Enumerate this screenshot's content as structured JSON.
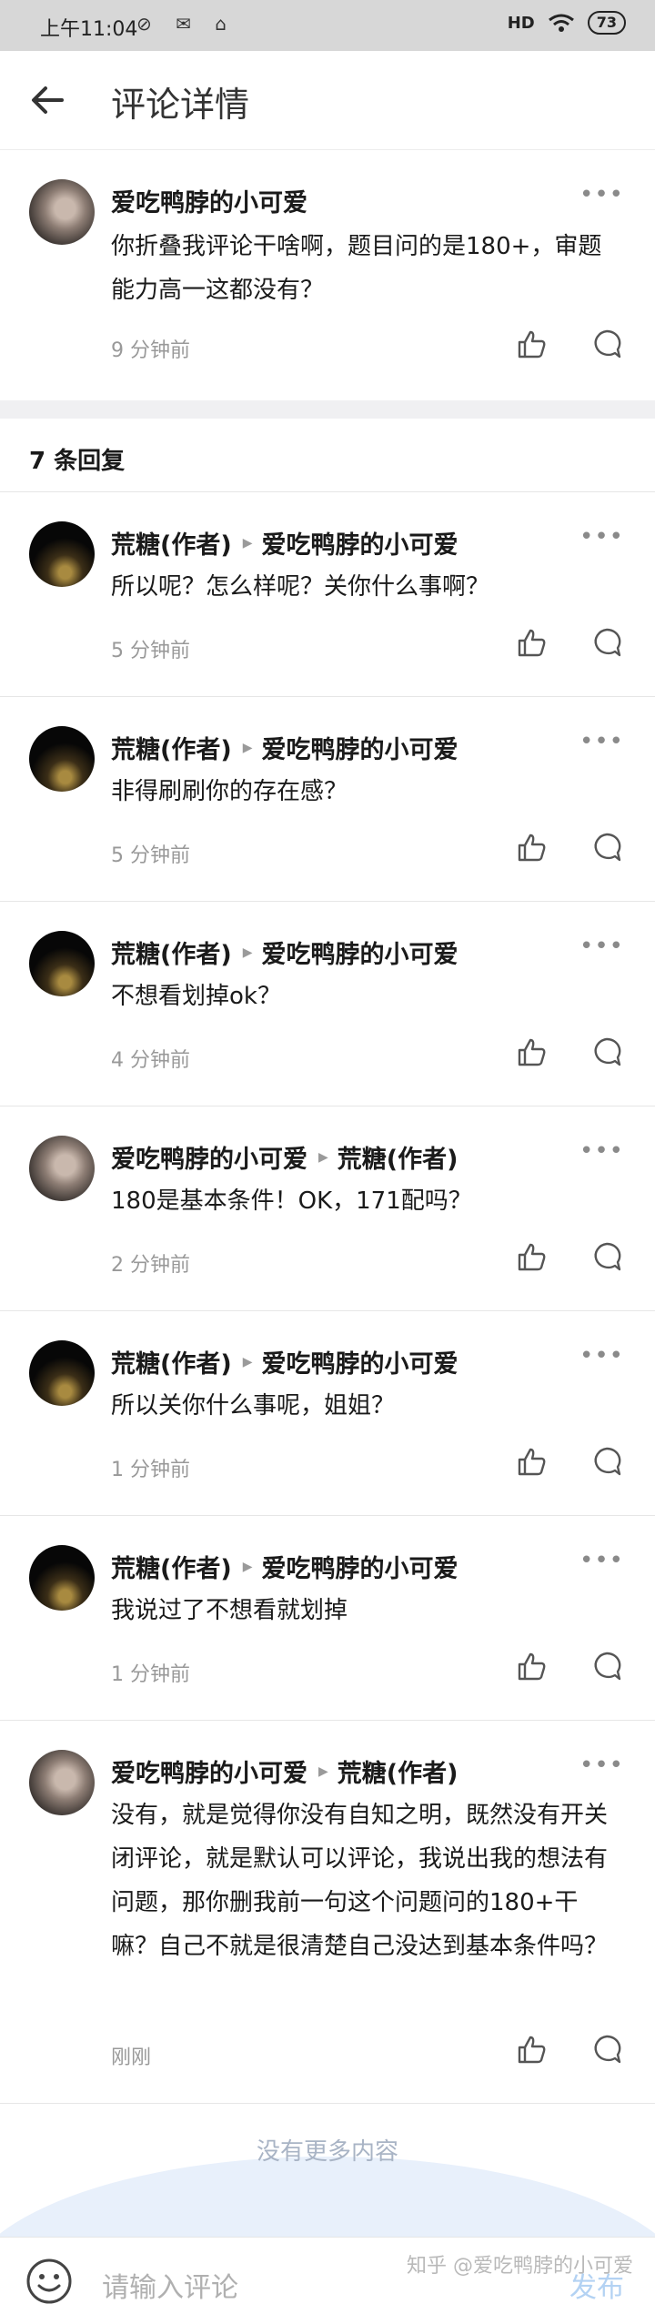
{
  "status": {
    "time": "上午11:04",
    "icons": "⊘ ✉ ⌂",
    "signal": "HD",
    "battery": "73"
  },
  "header": {
    "title": "评论详情"
  },
  "main_comment": {
    "author": "爱吃鸭脖的小可爱",
    "text": "你折叠我评论干啥啊，题目问的是180+，审题能力高一这都没有？",
    "time": "9 分钟前"
  },
  "reply_count": "7 条回复",
  "replies": [
    {
      "from": "荒糖(作者)",
      "to": "爱吃鸭脖的小可爱",
      "text": "所以呢？怎么样呢？关你什么事啊？",
      "time": "5 分钟前"
    },
    {
      "from": "荒糖(作者)",
      "to": "爱吃鸭脖的小可爱",
      "text": "非得刷刷你的存在感？",
      "time": "5 分钟前"
    },
    {
      "from": "荒糖(作者)",
      "to": "爱吃鸭脖的小可爱",
      "text": "不想看划掉ok？",
      "time": "4 分钟前"
    },
    {
      "from": "爱吃鸭脖的小可爱",
      "to": "荒糖(作者)",
      "text": "180是基本条件！OK，171配吗？",
      "time": "2 分钟前"
    },
    {
      "from": "荒糖(作者)",
      "to": "爱吃鸭脖的小可爱",
      "text": "所以关你什么事呢，姐姐？",
      "time": "1 分钟前"
    },
    {
      "from": "荒糖(作者)",
      "to": "爱吃鸭脖的小可爱",
      "text": "我说过了不想看就划掉",
      "time": "1 分钟前"
    },
    {
      "from": "爱吃鸭脖的小可爱",
      "to": "荒糖(作者)",
      "text": "没有，就是觉得你没有自知之明，既然没有开关闭评论，就是默认可以评论，我说出我的想法有问题，那你删我前一句这个问题问的180+干嘛？自己不就是很清楚自己没达到基本条件吗？",
      "time": "刚刚"
    }
  ],
  "more_label": "•••",
  "no_more": "没有更多内容",
  "input": {
    "placeholder": "请输入评论",
    "send": "发布"
  },
  "watermark": "知乎 @爱吃鸭脖的小可爱",
  "colors": {
    "accent": "#b3d2f3",
    "muted": "#999999"
  }
}
